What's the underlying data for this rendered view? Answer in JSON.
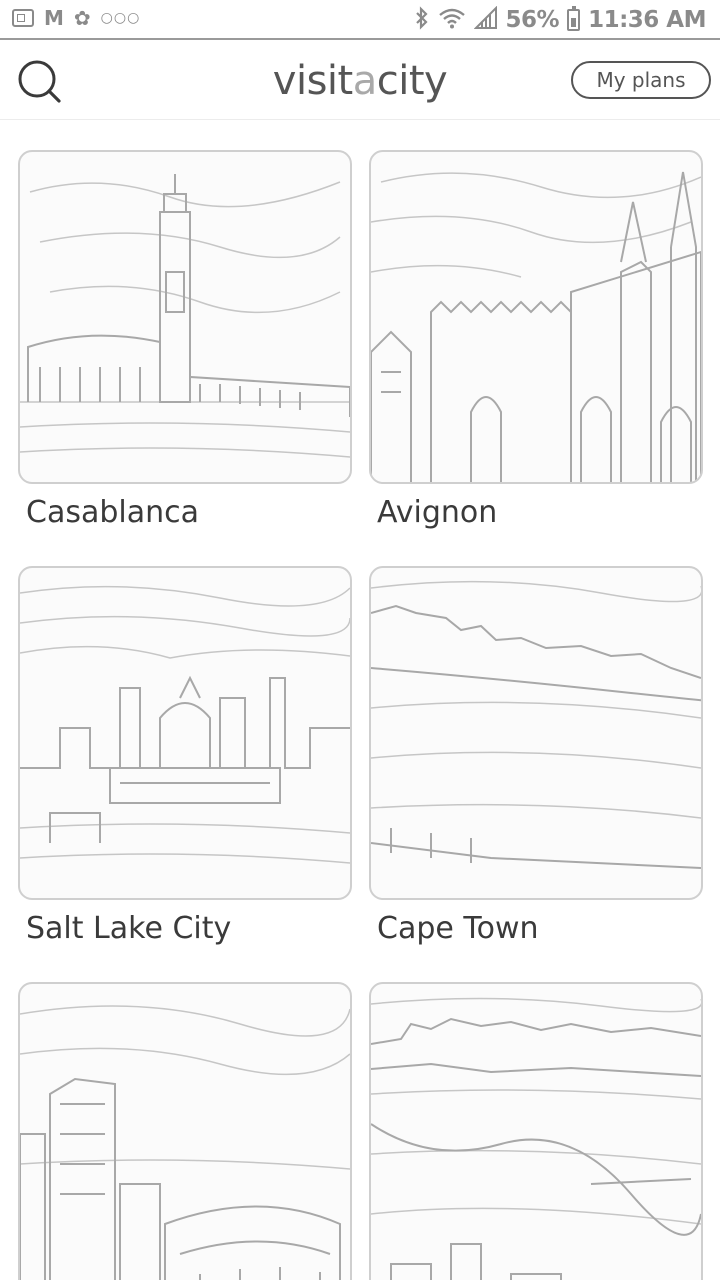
{
  "status_bar": {
    "left_icons": [
      "gallery-notification-icon",
      "gmail-notification-icon",
      "flower-notification-icon",
      "more-notifications-icon"
    ],
    "right_icons": [
      "bluetooth-icon",
      "wifi-icon",
      "signal-icon",
      "battery-icon"
    ],
    "battery_percent": "56%",
    "time": "11:36 AM"
  },
  "header": {
    "brand_part1": "visit",
    "brand_accent": "a",
    "brand_part2": "city",
    "search_icon": "search-icon",
    "my_plans_label": "My plans"
  },
  "cities": [
    {
      "name": "Casablanca",
      "image_icon": "mosque-minaret-icon"
    },
    {
      "name": "Avignon",
      "image_icon": "palace-towers-icon"
    },
    {
      "name": "Salt Lake City",
      "image_icon": "city-skyline-icon"
    },
    {
      "name": "Cape Town",
      "image_icon": "mountain-coast-icon"
    },
    {
      "name": "",
      "image_icon": "stadium-city-icon"
    },
    {
      "name": "",
      "image_icon": "harbor-city-icon"
    }
  ],
  "colors": {
    "text": "#3a3a3a",
    "muted": "#8a8a8a",
    "accent": "#a9a9a9",
    "border": "#cfcfcf",
    "background": "#ffffff"
  }
}
